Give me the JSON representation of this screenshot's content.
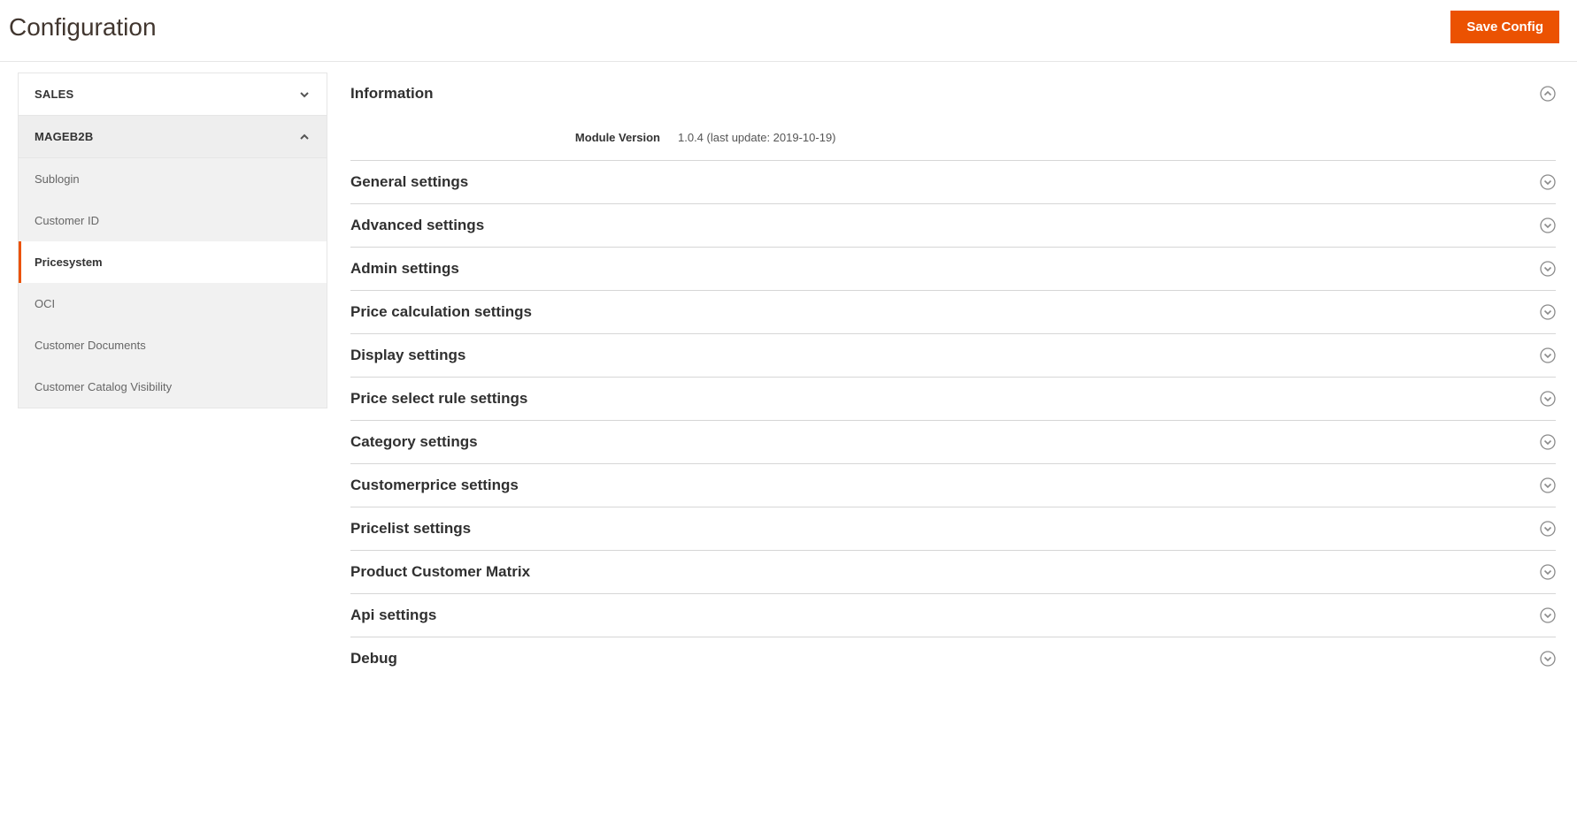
{
  "header": {
    "title": "Configuration",
    "save_label": "Save Config"
  },
  "sidebar": {
    "groups": [
      {
        "label": "SALES",
        "expanded": false,
        "items": []
      },
      {
        "label": "MAGEB2B",
        "expanded": true,
        "items": [
          {
            "label": "Sublogin",
            "active": false
          },
          {
            "label": "Customer ID",
            "active": false
          },
          {
            "label": "Pricesystem",
            "active": true
          },
          {
            "label": "OCI",
            "active": false
          },
          {
            "label": "Customer Documents",
            "active": false
          },
          {
            "label": "Customer Catalog Visibility",
            "active": false
          }
        ]
      }
    ]
  },
  "sections": {
    "information": {
      "title": "Information",
      "module_version_label": "Module Version",
      "module_version_value": "1.0.4 (last update: 2019-10-19)"
    },
    "general": {
      "title": "General settings"
    },
    "advanced": {
      "title": "Advanced settings"
    },
    "admin": {
      "title": "Admin settings"
    },
    "price_calc": {
      "title": "Price calculation settings"
    },
    "display": {
      "title": "Display settings"
    },
    "price_select_rule": {
      "title": "Price select rule settings"
    },
    "category": {
      "title": "Category settings"
    },
    "customerprice": {
      "title": "Customerprice settings"
    },
    "pricelist": {
      "title": "Pricelist settings"
    },
    "product_customer_matrix": {
      "title": "Product Customer Matrix"
    },
    "api": {
      "title": "Api settings"
    },
    "debug": {
      "title": "Debug"
    }
  }
}
